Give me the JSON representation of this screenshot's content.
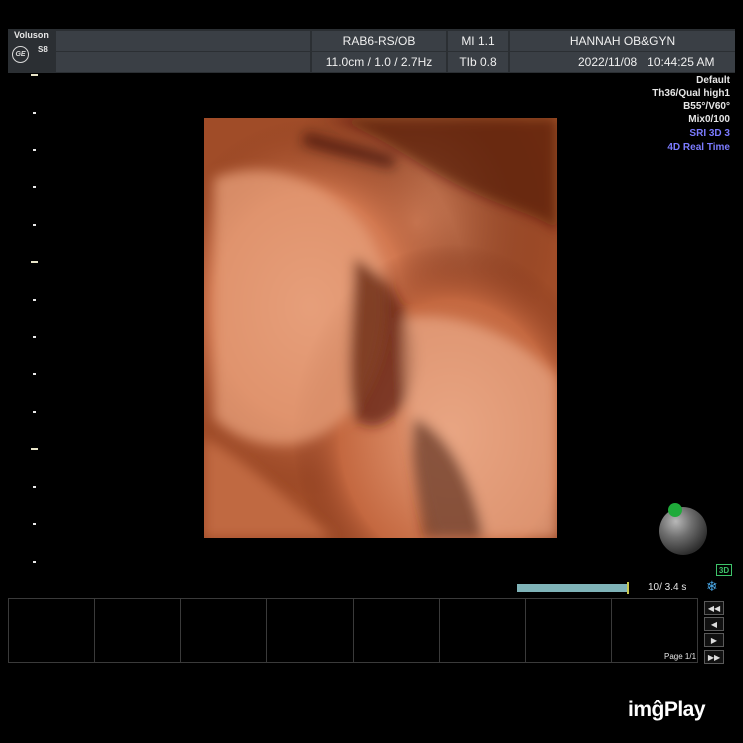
{
  "header": {
    "brand": "Voluson",
    "model": "S8",
    "logo_text": "GE",
    "probe": "RAB6-RS/OB",
    "mi": "MI  1.1",
    "institution": "HANNAH OB&GYN",
    "depth_freq": "11.0cm / 1.0 / 2.7Hz",
    "tib": "TIb  0.8",
    "date": "2022/11/08",
    "time": "10:44:25 AM"
  },
  "overlay": {
    "lines": [
      "Default",
      "Th36/Qual high1",
      "B55°/V60°",
      "Mix0/100"
    ],
    "blue_lines": [
      "SRI 3D 3",
      "4D Real Time"
    ]
  },
  "orientation": {
    "badge": "3D"
  },
  "cine": {
    "frames": "10/ 3.4 s",
    "icon": "snowflake-icon"
  },
  "page": {
    "label": "Page 1/1"
  },
  "nav": {
    "icons": [
      "double-left-icon",
      "left-icon",
      "right-icon",
      "double-right-icon"
    ]
  },
  "watermark": {
    "text": "imĝPlay"
  },
  "colors": {
    "accent_blue": "#7b7bff",
    "render_tone": "#c8683a",
    "status_green": "#3ec46a"
  }
}
